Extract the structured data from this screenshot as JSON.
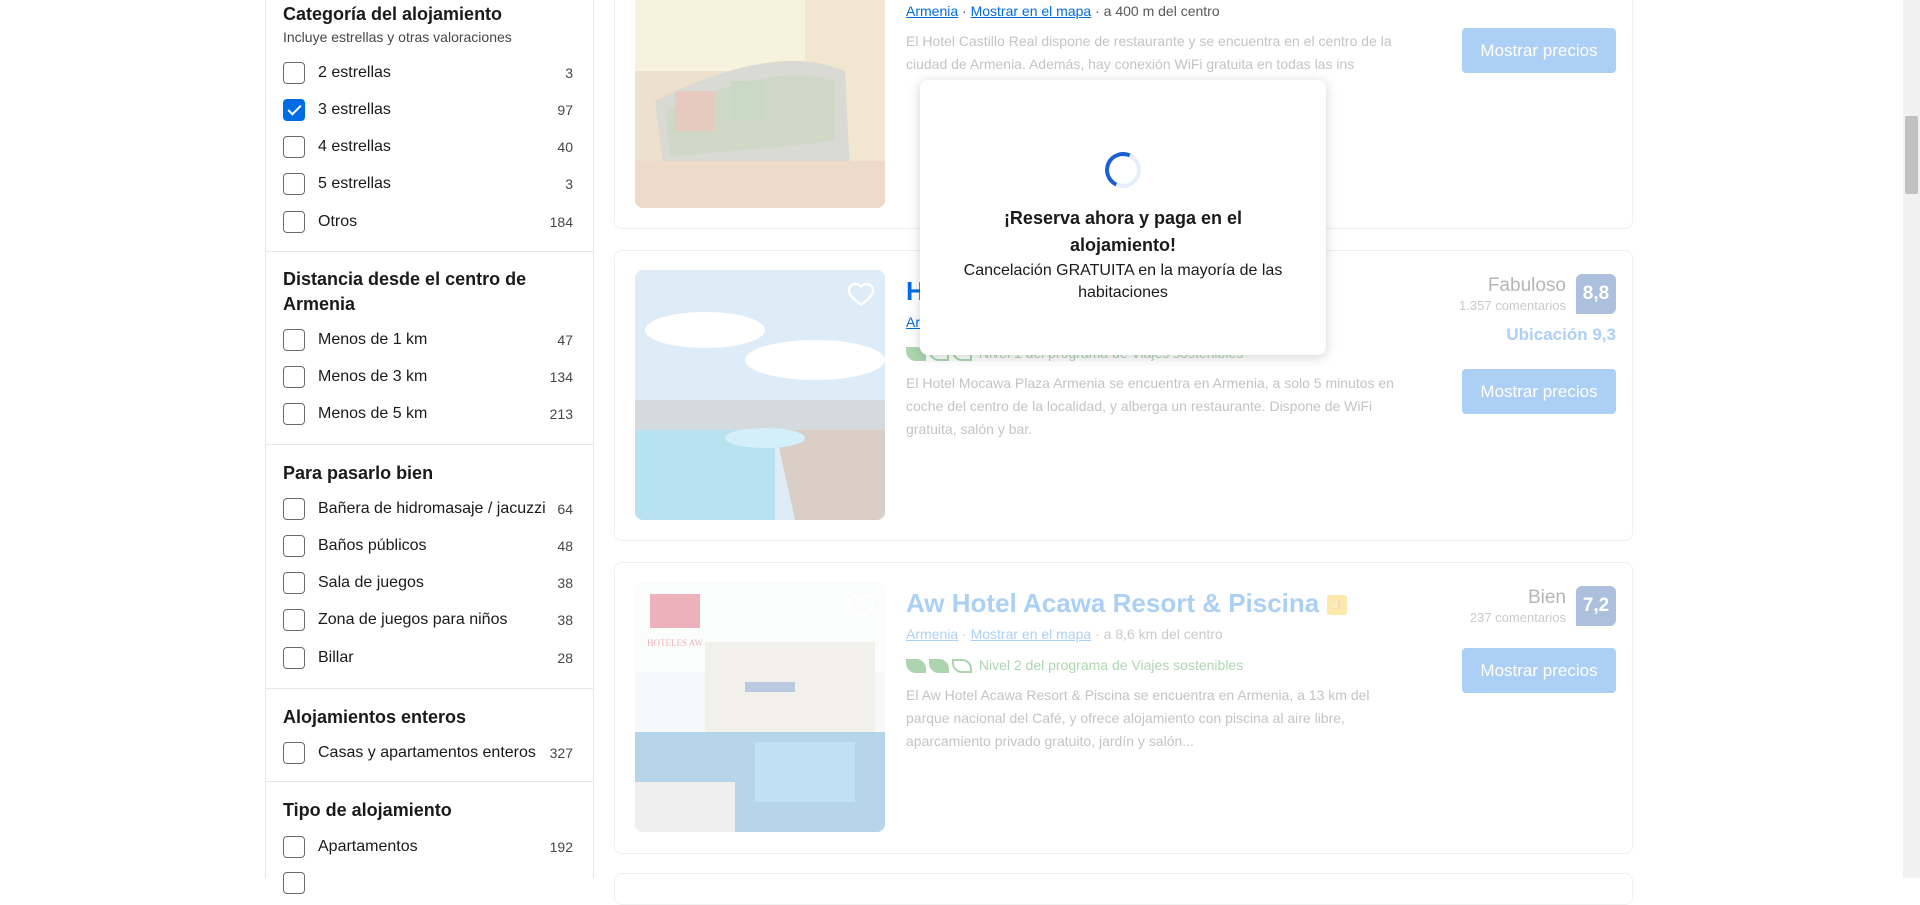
{
  "filters": {
    "category": {
      "title": "Categoría del alojamiento",
      "subtitle": "Incluye estrellas y otras valoraciones",
      "options": [
        {
          "label": "2 estrellas",
          "count": "3",
          "checked": false
        },
        {
          "label": "3 estrellas",
          "count": "97",
          "checked": true
        },
        {
          "label": "4 estrellas",
          "count": "40",
          "checked": false
        },
        {
          "label": "5 estrellas",
          "count": "3",
          "checked": false
        },
        {
          "label": "Otros",
          "count": "184",
          "checked": false
        }
      ]
    },
    "distance": {
      "title_line1": "Distancia desde el centro de",
      "title_line2": "Armenia",
      "options": [
        {
          "label": "Menos de 1 km",
          "count": "47"
        },
        {
          "label": "Menos de 3 km",
          "count": "134"
        },
        {
          "label": "Menos de 5 km",
          "count": "213"
        }
      ]
    },
    "fun": {
      "title": "Para pasarlo bien",
      "options": [
        {
          "label": "Bañera de hidromasaje / jacuzzi",
          "count": "64"
        },
        {
          "label": "Baños públicos",
          "count": "48"
        },
        {
          "label": "Sala de juegos",
          "count": "38"
        },
        {
          "label": "Zona de juegos para niños",
          "count": "38"
        },
        {
          "label": "Billar",
          "count": "28"
        }
      ]
    },
    "entire": {
      "title": "Alojamientos enteros",
      "options": [
        {
          "label": "Casas y apartamentos enteros",
          "count": "327"
        }
      ]
    },
    "type": {
      "title": "Tipo de alojamiento",
      "options": [
        {
          "label": "Apartamentos",
          "count": "192"
        }
      ]
    }
  },
  "results": [
    {
      "location": "Armenia",
      "map_link": "Mostrar en el mapa",
      "distance": "a 400 m del centro",
      "description": "El Hotel Castillo Real dispone de restaurante y se encuentra en el centro de la ciudad de Armenia. Además, hay conexión WiFi gratuita en todas las ins",
      "button": "Mostrar precios"
    },
    {
      "name_start": "H",
      "location_start": "Ar",
      "sustain": "Nivel 1 del programa de Viajes sostenibles",
      "description": "El Hotel Mocawa Plaza Armenia se encuentra en Armenia, a solo 5 minutos en coche del centro de la localidad, y alberga un restaurante. Dispone de WiFi gratuita, salón y bar.",
      "score_word": "Fabuloso",
      "review_count": "1.357 comentarios",
      "score": "8,8",
      "location_score": "Ubicación 9,3",
      "button": "Mostrar precios"
    },
    {
      "name": "Aw Hotel Acawa Resort & Piscina",
      "location": "Armenia",
      "map_link": "Mostrar en el mapa",
      "distance": "a 8,6 km del centro",
      "sustain": "Nivel 2 del programa de Viajes sostenibles",
      "description": "El Aw Hotel Acawa Resort & Piscina se encuentra en Armenia, a 13 km del parque nacional del Café, y ofrece alojamiento con piscina al aire libre, aparcamiento privado gratuito, jardín y salón...",
      "score_word": "Bien",
      "review_count": "237 comentarios",
      "score": "7,2",
      "button": "Mostrar precios",
      "logo_text": "HOTELES AW"
    }
  ],
  "popup": {
    "title": "¡Reserva ahora y paga en el alojamiento!",
    "text": "Cancelación GRATUITA en la mayoría de las habitaciones"
  },
  "separator": "·"
}
